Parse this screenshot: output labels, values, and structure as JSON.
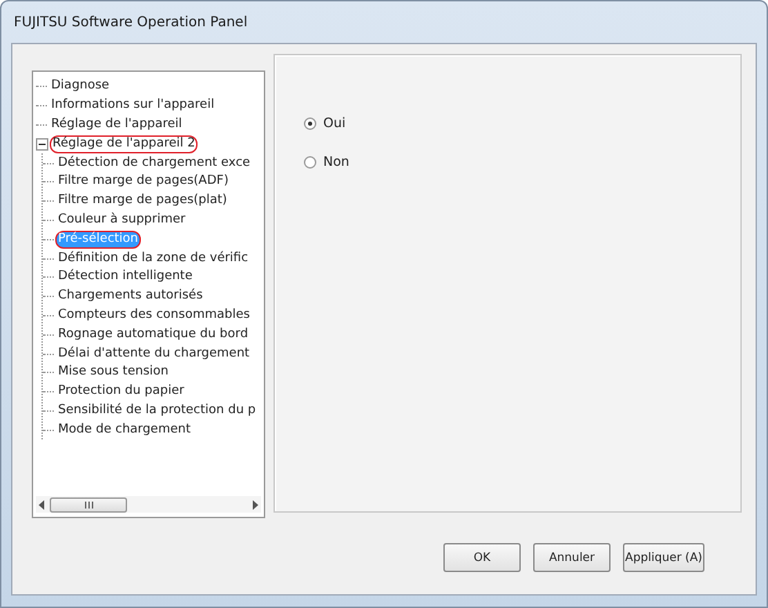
{
  "window": {
    "title": "FUJITSU Software Operation Panel"
  },
  "tree": {
    "items": [
      {
        "label": "Diagnose",
        "selected": false,
        "annotated": false
      },
      {
        "label": "Informations sur l'appareil",
        "selected": false,
        "annotated": false
      },
      {
        "label": "Réglage de l'appareil",
        "selected": false,
        "annotated": false
      },
      {
        "label": "Réglage de l'appareil 2",
        "selected": false,
        "annotated": true,
        "expanded": true,
        "children": [
          {
            "label": "Détection de chargement exce",
            "selected": false,
            "annotated": false
          },
          {
            "label": "Filtre marge de pages(ADF)",
            "selected": false,
            "annotated": false
          },
          {
            "label": "Filtre marge de pages(plat)",
            "selected": false,
            "annotated": false
          },
          {
            "label": "Couleur à supprimer",
            "selected": false,
            "annotated": false
          },
          {
            "label": "Pré-sélection",
            "selected": true,
            "annotated": true
          },
          {
            "label": "Définition de la zone de vérific",
            "selected": false,
            "annotated": false
          },
          {
            "label": "Détection intelligente",
            "selected": false,
            "annotated": false
          },
          {
            "label": "Chargements autorisés",
            "selected": false,
            "annotated": false
          },
          {
            "label": "Compteurs des consommables",
            "selected": false,
            "annotated": false
          },
          {
            "label": "Rognage automatique du bord",
            "selected": false,
            "annotated": false
          },
          {
            "label": "Délai d'attente du chargement",
            "selected": false,
            "annotated": false
          },
          {
            "label": "Mise sous tension",
            "selected": false,
            "annotated": false
          },
          {
            "label": "Protection du papier",
            "selected": false,
            "annotated": false
          },
          {
            "label": "Sensibilité de la protection du p",
            "selected": false,
            "annotated": false
          },
          {
            "label": "Mode de chargement",
            "selected": false,
            "annotated": false
          }
        ]
      }
    ]
  },
  "options": [
    {
      "label": "Oui",
      "selected": true
    },
    {
      "label": "Non",
      "selected": false
    }
  ],
  "buttons": [
    {
      "label": "OK"
    },
    {
      "label": "Annuler"
    },
    {
      "label": "Appliquer (A)"
    }
  ]
}
